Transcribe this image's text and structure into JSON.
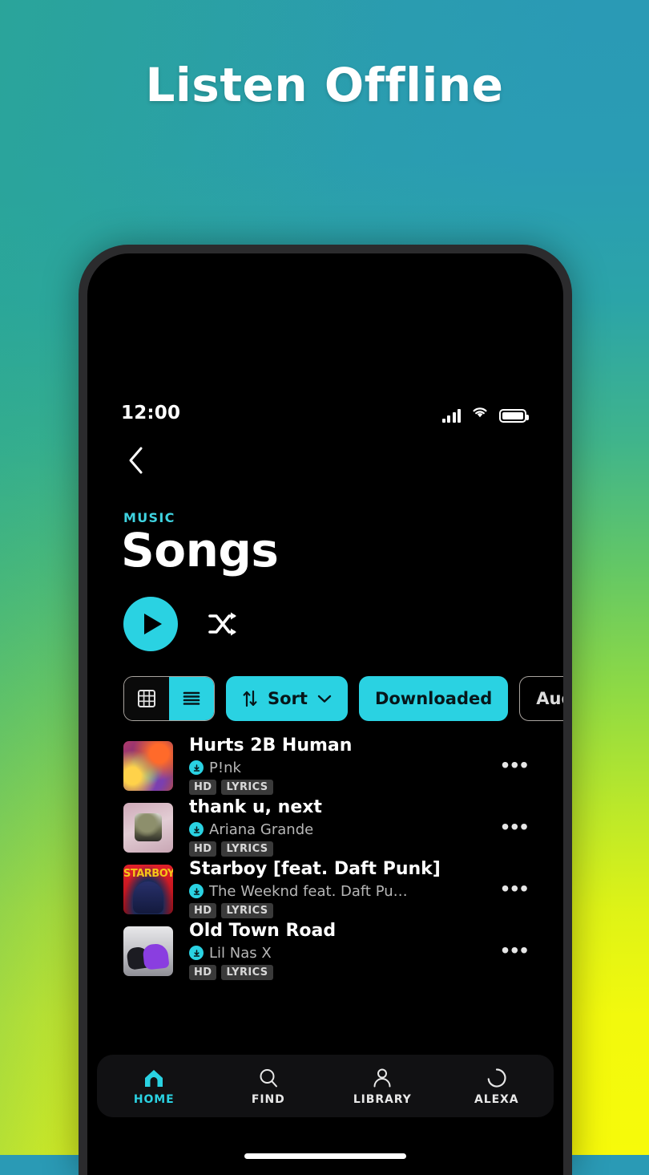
{
  "promo": {
    "headline": "Listen Offline",
    "bg_top_color": "#2a9ab5",
    "bg_bottom_color": "#f7fa0a"
  },
  "statusbar": {
    "time": "12:00",
    "signal_icon": "cellular-signal-icon",
    "wifi_icon": "wifi-icon",
    "battery_icon": "battery-icon"
  },
  "navigation": {
    "back_icon": "chevron-left-icon"
  },
  "header": {
    "eyebrow": "MUSIC",
    "title": "Songs",
    "accent_color": "#2ad2e2"
  },
  "controls": {
    "play_icon": "play-icon",
    "shuffle_icon": "shuffle-icon"
  },
  "filters": {
    "view_grid_icon": "grid-view-icon",
    "view_list_icon": "list-view-icon",
    "view_selected": "list",
    "chips": [
      {
        "label": "Sort",
        "style": "filled",
        "leading_icon": "sort-arrows-icon",
        "trailing_icon": "chevron-down-icon"
      },
      {
        "label": "Downloaded",
        "style": "filled"
      },
      {
        "label": "Audio",
        "style": "outline"
      }
    ]
  },
  "tracks": [
    {
      "title": "Hurts 2B Human",
      "artist": "P!nk",
      "downloaded": true,
      "tags": [
        "HD",
        "LYRICS"
      ],
      "art": "hurts",
      "more_icon": "more-options-icon"
    },
    {
      "title": "thank u, next",
      "artist": "Ariana Grande",
      "downloaded": true,
      "tags": [
        "HD",
        "LYRICS"
      ],
      "art": "tun",
      "more_icon": "more-options-icon"
    },
    {
      "title": "Starboy [feat. Daft Punk]",
      "artist": "The Weeknd feat. Daft Pu…",
      "downloaded": true,
      "tags": [
        "HD",
        "LYRICS"
      ],
      "art": "starboy",
      "art_text": "STARBOY",
      "more_icon": "more-options-icon"
    },
    {
      "title": "Old Town Road",
      "artist": "Lil Nas X",
      "downloaded": true,
      "tags": [
        "HD",
        "LYRICS"
      ],
      "art": "otr",
      "more_icon": "more-options-icon"
    }
  ],
  "bottom_nav": {
    "items": [
      {
        "label": "HOME",
        "icon": "home-icon",
        "active": true
      },
      {
        "label": "FIND",
        "icon": "search-icon",
        "active": false
      },
      {
        "label": "LIBRARY",
        "icon": "person-icon",
        "active": false
      },
      {
        "label": "ALEXA",
        "icon": "alexa-ring-icon",
        "active": false
      }
    ]
  }
}
